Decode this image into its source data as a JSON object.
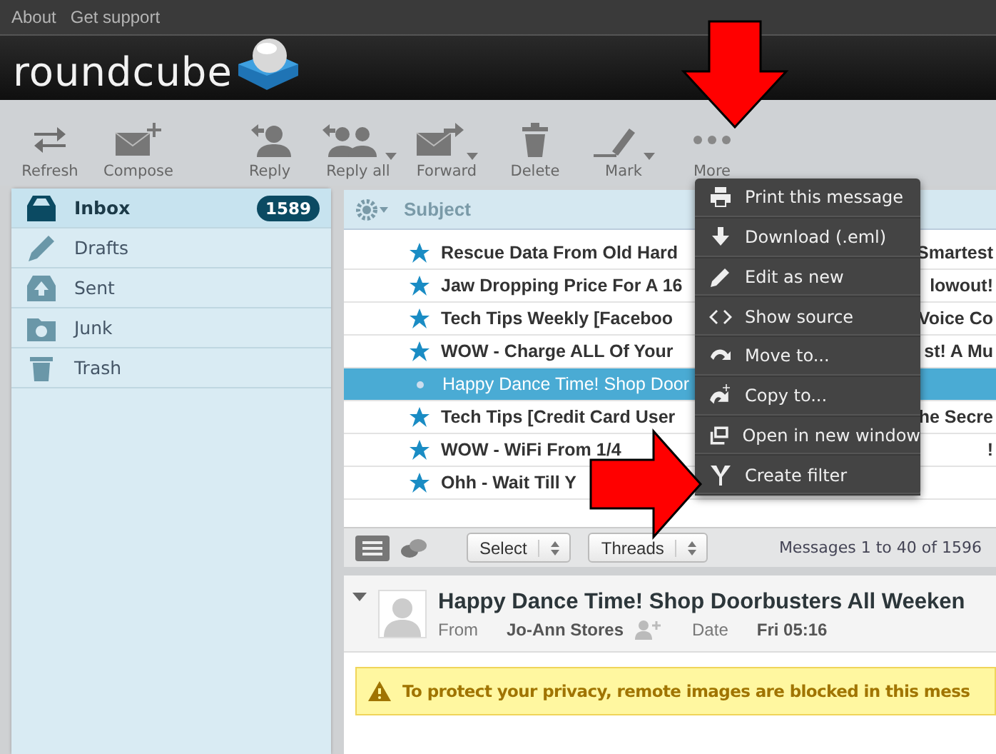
{
  "top_links": [
    "About",
    "Get support"
  ],
  "logo": {
    "text": "roundcube"
  },
  "toolbar": [
    {
      "kind": "refresh",
      "label": "Refresh",
      "dropdown": false
    },
    {
      "kind": "compose",
      "label": "Compose",
      "dropdown": false
    },
    {
      "kind": "reply",
      "label": "Reply",
      "dropdown": false
    },
    {
      "kind": "replyall",
      "label": "Reply all",
      "dropdown": true
    },
    {
      "kind": "forward",
      "label": "Forward",
      "dropdown": true
    },
    {
      "kind": "delete",
      "label": "Delete",
      "dropdown": false
    },
    {
      "kind": "mark",
      "label": "Mark",
      "dropdown": true
    },
    {
      "kind": "more",
      "label": "More",
      "dropdown": false
    }
  ],
  "folders": [
    {
      "kind": "inbox",
      "name": "Inbox",
      "count": "1589",
      "selected": true
    },
    {
      "kind": "drafts",
      "name": "Drafts",
      "selected": false
    },
    {
      "kind": "sent",
      "name": "Sent",
      "selected": false
    },
    {
      "kind": "junk",
      "name": "Junk",
      "selected": false
    },
    {
      "kind": "trash",
      "name": "Trash",
      "selected": false
    }
  ],
  "message_list": {
    "header": "Subject",
    "rows": [
      {
        "start": "Rescue Data From Old Hard",
        "end": "Smartest",
        "flagged": true,
        "unread": true,
        "selected": false
      },
      {
        "start": "Jaw Dropping Price For A 16",
        "end": "lowout!",
        "flagged": true,
        "unread": true,
        "selected": false
      },
      {
        "start": "Tech Tips Weekly [Faceboo",
        "end": "Voice Co",
        "flagged": true,
        "unread": true,
        "selected": false
      },
      {
        "start": "WOW - Charge ALL Of Your",
        "end": "st! A Mu",
        "flagged": true,
        "unread": true,
        "selected": false
      },
      {
        "start": "Happy Dance Time! Shop Door",
        "flagged": false,
        "unread": false,
        "selected": true
      },
      {
        "start": "Tech Tips [Credit Card User",
        "end": "he Secre",
        "flagged": true,
        "unread": true,
        "selected": false
      },
      {
        "start": "WOW - WiFi From 1/4",
        "end": "!",
        "flagged": true,
        "unread": true,
        "selected": false
      },
      {
        "start": "Ohh - Wait Till Y",
        "flagged": true,
        "unread": true,
        "selected": false
      }
    ],
    "footer": {
      "select": "Select",
      "threads": "Threads",
      "count": "Messages 1 to 40 of 1596"
    }
  },
  "more_menu": [
    {
      "kind": "print",
      "label": "Print this message"
    },
    {
      "kind": "download",
      "label": "Download (.eml)"
    },
    {
      "kind": "edit",
      "label": "Edit as new"
    },
    {
      "kind": "source",
      "label": "Show source"
    },
    {
      "kind": "move",
      "label": "Move to..."
    },
    {
      "kind": "copy",
      "label": "Copy to..."
    },
    {
      "kind": "window",
      "label": "Open in new window"
    },
    {
      "kind": "filter",
      "label": "Create filter"
    }
  ],
  "preview": {
    "subject": "Happy Dance Time! Shop Doorbusters All Weeken",
    "from_label": "From",
    "from": "Jo-Ann Stores",
    "date_label": "Date",
    "date": "Fri 05:16",
    "warning": "To protect your privacy, remote images are blocked in this mess"
  }
}
